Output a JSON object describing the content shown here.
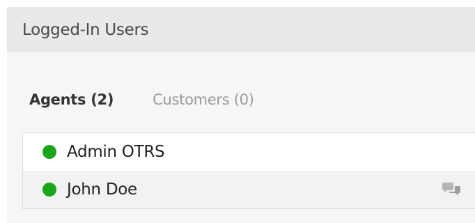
{
  "widget": {
    "title": "Logged-In Users"
  },
  "tabs": [
    {
      "label": "Agents (2)",
      "active": true
    },
    {
      "label": "Customers (0)",
      "active": false
    }
  ],
  "users": [
    {
      "name": "Admin OTRS",
      "status": "online",
      "icon": null
    },
    {
      "name": "John Doe",
      "status": "online",
      "icon": "chat-icon"
    }
  ],
  "colors": {
    "online": "#1aa61a",
    "header_bg": "#e9e9e9",
    "panel_bg": "#f6f6f6",
    "row_alt_bg": "#f2f2f2",
    "inactive_tab": "#9a9a9a"
  }
}
